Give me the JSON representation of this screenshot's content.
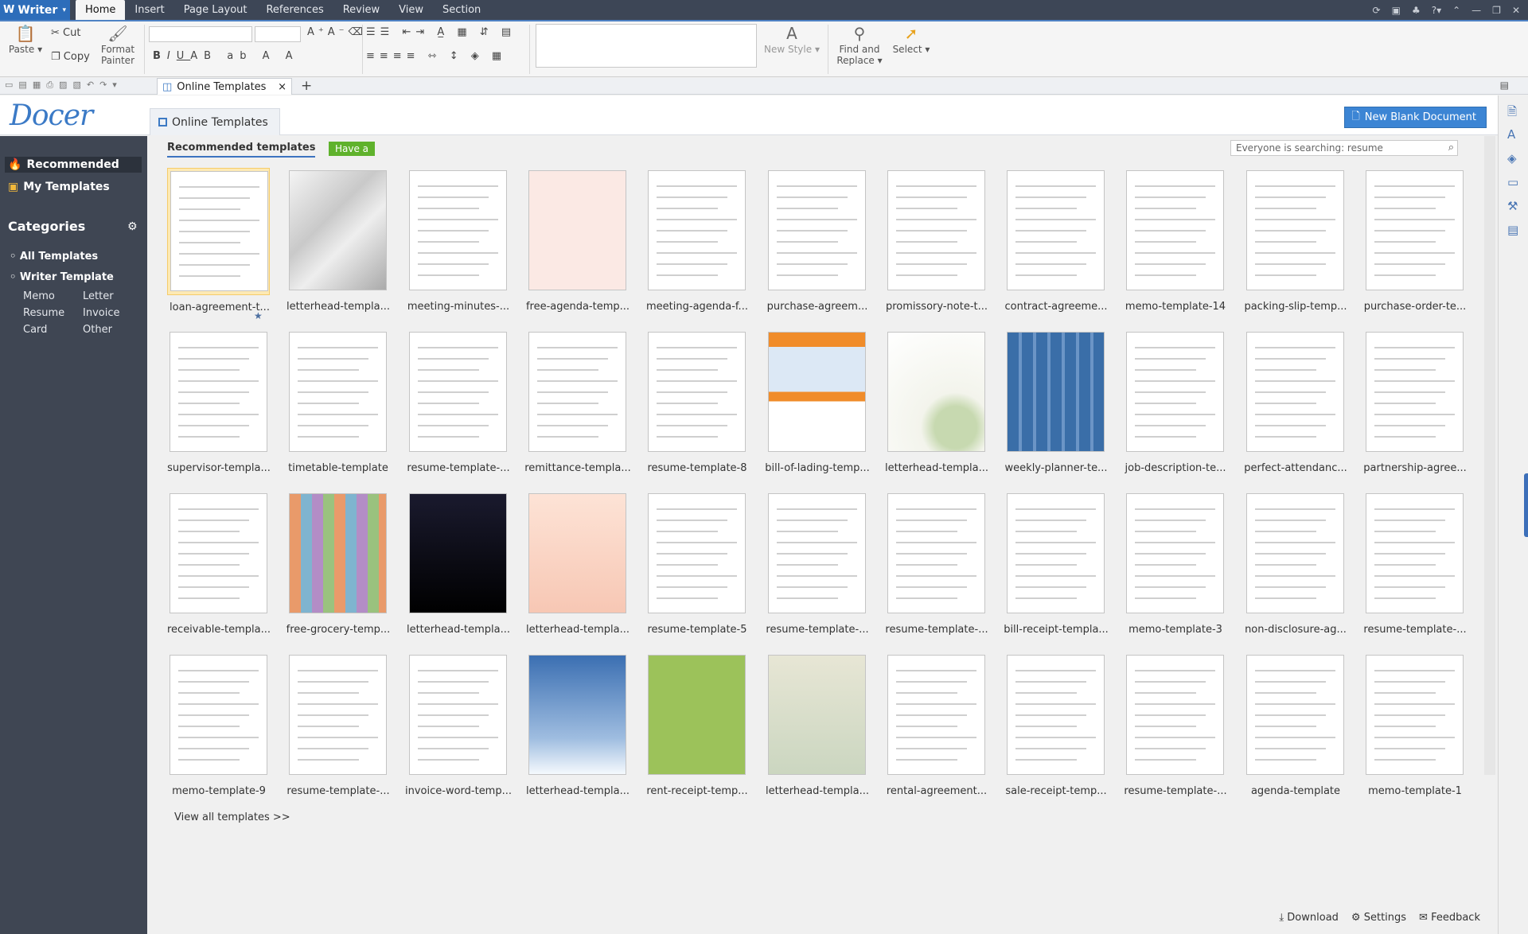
{
  "app": {
    "name": "Writer"
  },
  "menu": [
    "Home",
    "Insert",
    "Page Layout",
    "References",
    "Review",
    "View",
    "Section"
  ],
  "ribbon": {
    "paste": "Paste",
    "cut": "Cut",
    "copy": "Copy",
    "format_painter_1": "Format",
    "format_painter_2": "Painter",
    "new_style": "New Style",
    "find_replace_1": "Find and",
    "find_replace_2": "Replace",
    "select": "Select"
  },
  "tab": {
    "title": "Online Templates",
    "close": "×",
    "new": "+"
  },
  "header": {
    "logo": "Docer",
    "tab": "Online Templates",
    "new_blank": "New Blank Document"
  },
  "sidebar": {
    "recommended": "Recommended",
    "my_templates": "My Templates",
    "categories": "Categories",
    "all_templates": "All Templates",
    "writer_template": "Writer Template",
    "subcats": [
      "Memo",
      "Letter",
      "Resume",
      "Invoice",
      "Card",
      "Other"
    ]
  },
  "main": {
    "recommended_title": "Recommended templates",
    "have_a": "Have a",
    "search_placeholder": "Everyone is searching: resume",
    "view_all": "View all templates >>"
  },
  "templates": [
    "loan-agreement-t...",
    "letterhead-templa...",
    "meeting-minutes-...",
    "free-agenda-temp...",
    "meeting-agenda-f...",
    "purchase-agreem...",
    "promissory-note-t...",
    "contract-agreeme...",
    "memo-template-14",
    "packing-slip-temp...",
    "purchase-order-te...",
    "supervisor-templa...",
    "timetable-template",
    "resume-template-...",
    "remittance-templa...",
    "resume-template-8",
    "bill-of-lading-temp...",
    "letterhead-templa...",
    "weekly-planner-te...",
    "job-description-te...",
    "perfect-attendanc...",
    "partnership-agree...",
    "receivable-templa...",
    "free-grocery-temp...",
    "letterhead-templa...",
    "letterhead-templa...",
    "resume-template-5",
    "resume-template-...",
    "resume-template-...",
    "bill-receipt-templa...",
    "memo-template-3",
    "non-disclosure-ag...",
    "resume-template-...",
    "memo-template-9",
    "resume-template-...",
    "invoice-word-temp...",
    "letterhead-templa...",
    "rent-receipt-temp...",
    "letterhead-templa...",
    "rental-agreement...",
    "sale-receipt-temp...",
    "resume-template-...",
    "agenda-template",
    "memo-template-1"
  ],
  "thumb_styles": [
    "paper",
    "photo",
    "paper",
    "pink",
    "paper",
    "paper",
    "paper",
    "paper",
    "paper",
    "paper",
    "paper",
    "paper",
    "paper",
    "paper",
    "paper",
    "paper",
    "orange",
    "floral",
    "planner",
    "paper",
    "paper",
    "paper",
    "paper",
    "grocery",
    "dark",
    "peach",
    "paper",
    "paper",
    "paper",
    "paper",
    "paper",
    "paper",
    "paper",
    "paper",
    "paper",
    "paper",
    "winter",
    "green",
    "flower",
    "paper",
    "paper",
    "paper",
    "paper",
    "paper"
  ],
  "footer": {
    "download": "Download",
    "settings": "Settings",
    "feedback": "Feedback"
  },
  "colors": {
    "accent": "#3c85d4",
    "sidebar": "#3f4653",
    "topbar": "#3d4656",
    "have_a": "#5fb22c"
  }
}
